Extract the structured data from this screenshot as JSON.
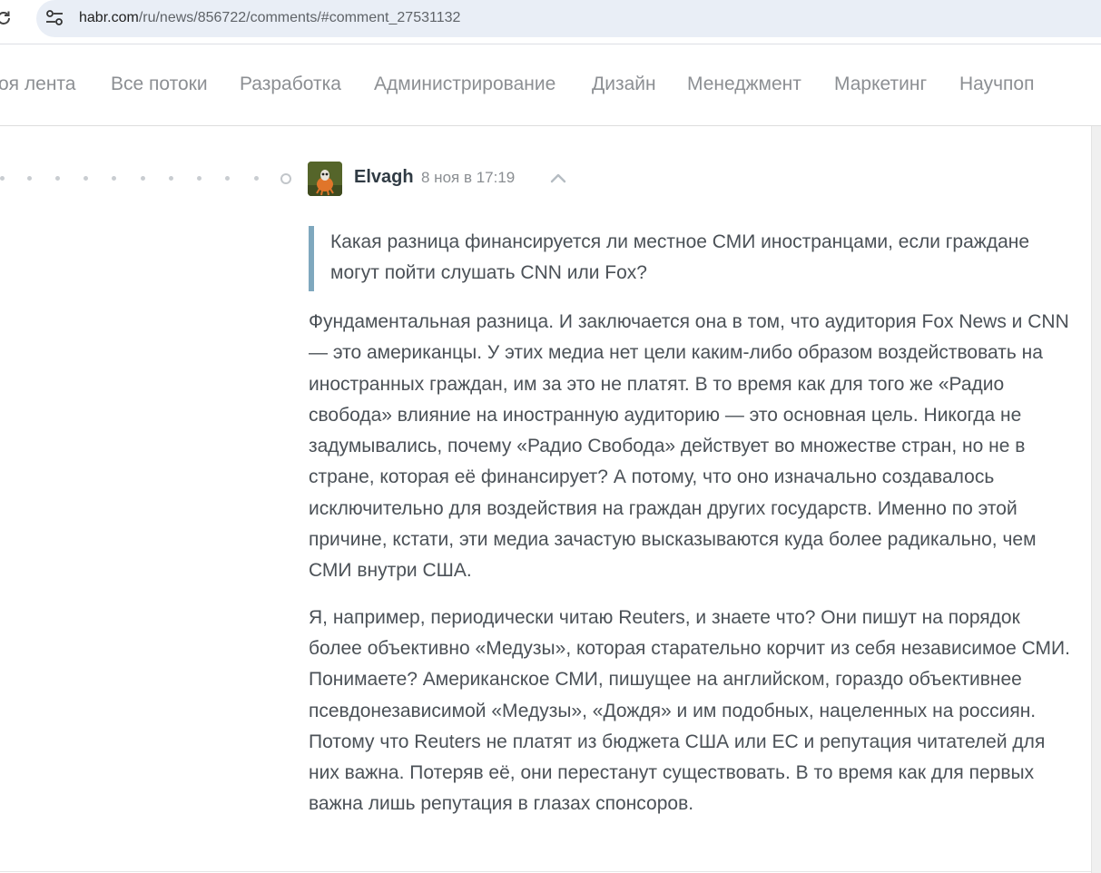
{
  "browser": {
    "url_host": "habr.com",
    "url_path": "/ru/news/856722/comments/#comment_27531132"
  },
  "nav": {
    "items": [
      "оя лента",
      "Все потоки",
      "Разработка",
      "Администрирование",
      "Дизайн",
      "Менеджмент",
      "Маркетинг",
      "Научпоп"
    ]
  },
  "comment": {
    "username": "Elvagh",
    "date": "8 ноя в 17:19",
    "quote": "Какая разница финансируется ли местное СМИ иностранцами, если граждане могут пойти слушать CNN или Fox?",
    "paragraphs": [
      "Фундаментальная разница. И заключается она в том, что аудитория Fox News и CNN — это американцы. У этих медиа нет цели каким-либо образом воздействовать на иностранных граждан, им за это не платят. В то время как для того же «Радио свобода» влияние на иностранную аудиторию — это основная цель. Никогда не задумывались, почему «Радио Свобода» действует во множестве стран, но не в стране, которая её финансирует? А потому, что оно изначально создавалось исключительно для воздействия на граждан других государств. Именно по этой причине, кстати, эти медиа зачастую высказываются куда более радикально, чем СМИ внутри США.",
      "Я, например, периодически читаю Reuters, и знаете что? Они пишут на порядок более объективно «Медузы», которая старательно корчит из себя независимое СМИ. Понимаете? Американское СМИ, пишущее на английском, гораздо объективнее псевдонезависимой «Медузы», «Дождя» и им подобных, нацеленных на россиян. Потому что Reuters не платят из бюджета США или ЕС и репутация читателей для них важна. Потеряв её, они перестанут существовать. В то время как для первых важна лишь репутация в глазах спонсоров."
    ]
  },
  "icons": {
    "reload": "reload-icon",
    "site_info": "site-info-icon",
    "collapse": "chevron-up-icon",
    "avatar": "avatar"
  },
  "colors": {
    "quote_border": "#7fa8be",
    "nav_text": "#8c8f93",
    "body_text": "#4b5157",
    "username": "#303b44"
  }
}
